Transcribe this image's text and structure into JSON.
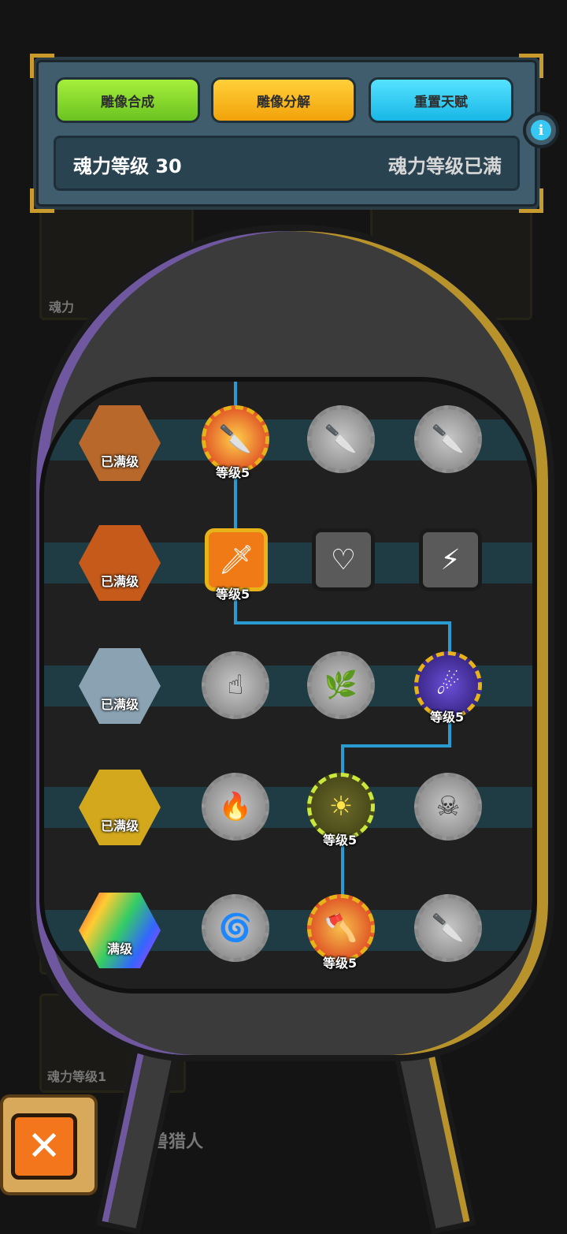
{
  "header": {
    "buttons": [
      "雕像合成",
      "雕像分解",
      "重置天赋"
    ],
    "soul_level_label": "魂力等级 30",
    "soul_level_status": "魂力等级已满"
  },
  "background": {
    "card_label_1": "魂力",
    "card_label_2": "魂力",
    "card_label_3": "魂力等级1",
    "monster_hunter": "怪兽猎人"
  },
  "talent_tree": {
    "rows": [
      {
        "statue": "已满级",
        "statue_color": "#b8682a",
        "nodes": [
          "等级5",
          "",
          ""
        ]
      },
      {
        "statue": "已满级",
        "statue_color": "#c55a1a",
        "nodes": [
          "等级5",
          "",
          ""
        ]
      },
      {
        "statue": "已满级",
        "statue_color": "#8aa2b2",
        "nodes": [
          "",
          "",
          "等级5"
        ]
      },
      {
        "statue": "已满级",
        "statue_color": "#d3a81c",
        "nodes": [
          "",
          "等级5",
          ""
        ]
      },
      {
        "statue": "满级",
        "statue_color": "#a23bd0",
        "nodes": [
          "",
          "等级5",
          ""
        ]
      }
    ]
  },
  "icons": {
    "close": "close-icon",
    "info": "info-icon",
    "sword": "sword-icon",
    "heart": "heart-icon",
    "lightning": "lightning-icon",
    "sun": "sun-icon",
    "fire": "fire-icon",
    "skull": "skull-icon"
  },
  "close_glyph": "✕",
  "info_glyph": "i"
}
